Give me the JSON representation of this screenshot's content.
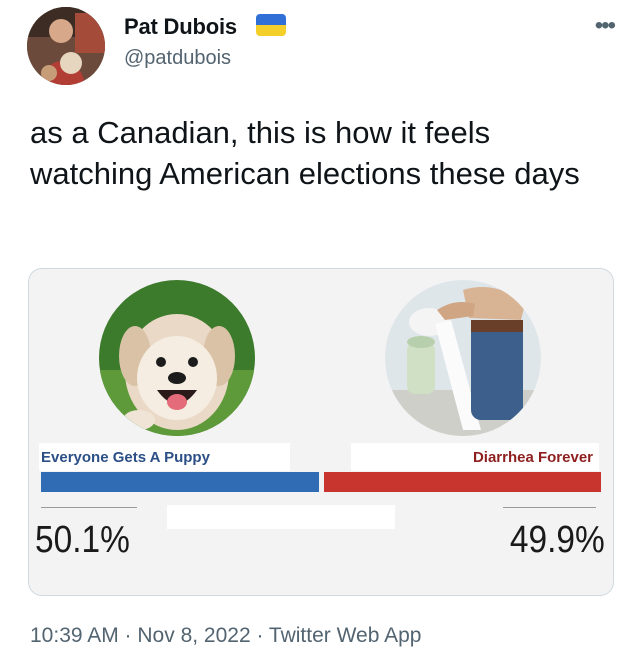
{
  "tweet": {
    "display_name": "Pat Dubois",
    "handle": "@patdubois",
    "more_label": "•••",
    "text": "as a Canadian, this is how it feels watching American elections these days",
    "timestamp_line": "10:39 AM · Nov 8, 2022 · Twitter Web App"
  },
  "poll": {
    "left": {
      "label": "Everyone Gets A Puppy",
      "percent": "50.1%",
      "share": 50.1,
      "color": "#2f6cb4"
    },
    "right": {
      "label": "Diarrhea Forever",
      "percent": "49.9%",
      "share": 49.9,
      "color": "#c8352e"
    }
  },
  "colors": {
    "text": "#0f1419",
    "secondary": "#536471",
    "flag_blue": "#2f6fd6",
    "flag_yellow": "#f4cf2a"
  },
  "icons": {
    "avatar": "avatar-photo",
    "flag": "ukraine-flag-icon",
    "more": "more-options-icon",
    "puppy": "puppy-photo",
    "toilet": "toilet-paper-photo"
  }
}
